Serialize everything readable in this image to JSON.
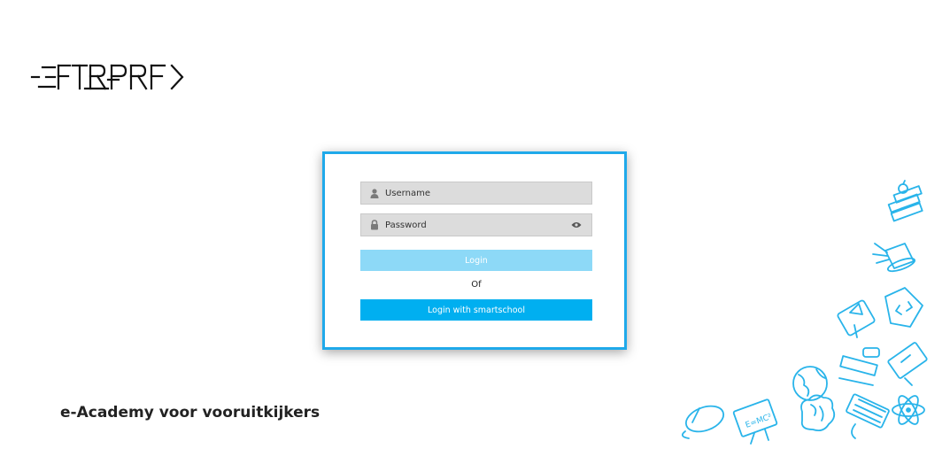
{
  "brand": {
    "logo_text": "FTRPRF"
  },
  "login": {
    "username_placeholder": "Username",
    "password_placeholder": "Password",
    "login_label": "Login",
    "or_label": "Of",
    "smartschool_label": "Login with smartschool"
  },
  "tagline": "e-Academy voor vooruitkijkers",
  "icons": {
    "user": "user-icon",
    "lock": "lock-icon",
    "eye": "eye-icon"
  },
  "colors": {
    "accent": "#00aff0",
    "login_button": "#8dd9f7",
    "card_border": "#1fa9ea",
    "field_bg": "#dcdcdc",
    "decor": "#29b4ea"
  }
}
